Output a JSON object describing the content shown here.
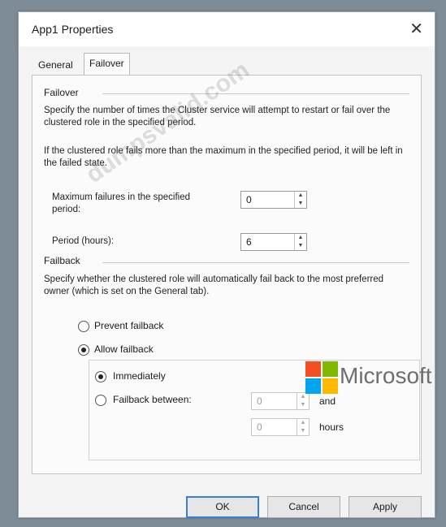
{
  "window": {
    "title": "App1 Properties",
    "close_glyph": "✕"
  },
  "tabs": [
    {
      "label": "General",
      "selected": false
    },
    {
      "label": "Failover",
      "selected": true
    }
  ],
  "failover": {
    "heading": "Failover",
    "description": "Specify the number of times the Cluster service will attempt to restart or fail over the clustered role in the specified period.",
    "note": "If the clustered role fails more than the maximum in the specified period, it will be left in the failed state.",
    "max_failures_label": "Maximum failures in the specified period:",
    "max_failures_value": "0",
    "period_label": "Period (hours):",
    "period_value": "6"
  },
  "failback": {
    "heading": "Failback",
    "description": "Specify whether the clustered role will automatically fail back to the most preferred owner (which is set on the General tab).",
    "prevent_label": "Prevent failback",
    "allow_label": "Allow failback",
    "immediately_label": "Immediately",
    "between_label": "Failback between:",
    "between_from": "0",
    "and_label": "and",
    "between_to": "0",
    "hours_label": "hours"
  },
  "buttons": {
    "ok": "OK",
    "cancel": "Cancel",
    "apply": "Apply"
  },
  "overlays": {
    "watermark_text": "dumpsvalid.com",
    "logo_text": "Microsoft",
    "logo_colors": [
      "#f25022",
      "#7fba00",
      "#00a4ef",
      "#ffb900"
    ]
  }
}
